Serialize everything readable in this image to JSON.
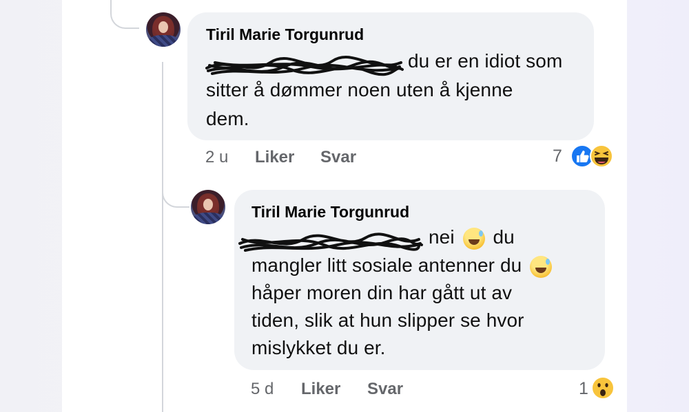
{
  "comment1": {
    "author": "Tiril Marie Torgunrud",
    "lines": [
      "du er en idiot som",
      "sitter å dømmer noen uten å kjenne",
      "dem."
    ],
    "time": "2 u",
    "like_label": "Liker",
    "reply_label": "Svar",
    "reaction_count": "7",
    "reactions": [
      "like-icon",
      "laughing-face-icon"
    ]
  },
  "comment2": {
    "author": "Tiril Marie Torgunrud",
    "line1_text": "nei",
    "line1_tail": "du",
    "line2": "mangler litt sosiale antenner du",
    "lines": [
      "håper moren din har gått ut av",
      "tiden, slik at hun slipper se hvor",
      "mislykket du er."
    ],
    "time": "5 d",
    "like_label": "Liker",
    "reply_label": "Svar",
    "reaction_count": "1",
    "reactions": [
      "wow-face-icon"
    ],
    "inline_emoji": "grinning-sweat-face-icon"
  },
  "colors": {
    "bubble": "#f0f2f5",
    "meta_text": "#65676b",
    "like_blue": "#1877f2",
    "emoji_yellow": "#f8c43c"
  }
}
